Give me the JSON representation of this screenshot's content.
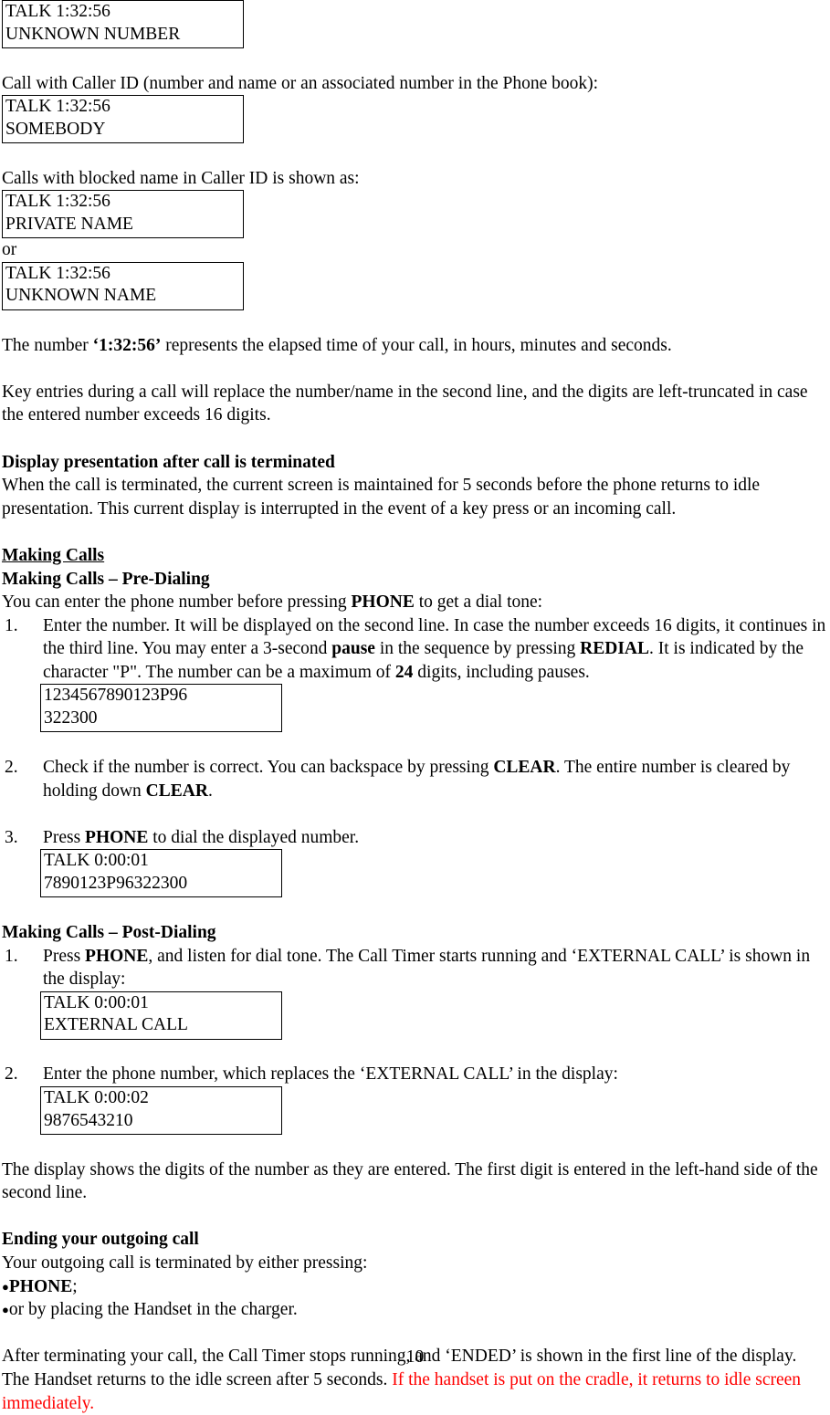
{
  "page": {
    "number": "10"
  },
  "colors": {
    "text": "#000000",
    "highlight_red": "#ff0000",
    "box_border": "#000000",
    "background": "#ffffff"
  },
  "blocks": {
    "lcd_unknown_number": {
      "line1": "TALK 1:32:56",
      "line2": "UNKNOWN NUMBER"
    },
    "caller_id_intro": "Call with Caller ID (number and name or an associated number in the Phone book):",
    "lcd_somebody": {
      "line1": "TALK 1:32:56",
      "line2": "SOMEBODY"
    },
    "blocked_name_intro": "Calls with blocked name in Caller ID is shown as:",
    "lcd_private_name": {
      "line1": "TALK 1:32:56",
      "line2": "PRIVATE NAME"
    },
    "or_label": "or",
    "lcd_unknown_name": {
      "line1": "TALK 1:32:56",
      "line2": "UNKNOWN NAME"
    },
    "elapsed_time_para": {
      "part1": "The number ",
      "bold": "‘1:32:56’",
      "part2": " represents the elapsed time of your call, in hours, minutes and seconds."
    },
    "key_entries_para": "Key entries during a call will replace the number/name in the second line, and the digits are left-truncated in case the entered number exceeds 16 digits.",
    "display_after_terminated": {
      "heading": "Display presentation after call is terminated",
      "body": "When the call is terminated, the current screen is maintained for 5 seconds before the phone returns to idle presentation. This current display is interrupted in the event of a key press or an incoming call."
    },
    "making_calls": {
      "heading": "Making Calls",
      "predialing_heading": "Making Calls – Pre-Dialing",
      "predialing_intro": {
        "part1": "You can enter the phone number before pressing ",
        "bold": "PHONE",
        "part2": " to get a dial tone:"
      },
      "step1": {
        "num": "1.",
        "t1": "Enter the number.  It will be displayed on the second line. In case the number exceeds 16 digits, it continues in the third line. You may enter a 3-second ",
        "b1": "pause",
        "t2": " in the sequence by pressing ",
        "b2": "REDIAL",
        "t3": ".  It is indicated by the character \"P\".  The number can be a maximum of ",
        "b3": "24",
        "t4": " digits, including pauses."
      },
      "lcd_entered_number": {
        "line1": "1234567890123P96",
        "line2": "322300"
      },
      "step2": {
        "num": "2.",
        "t1": "Check if the number is correct. You can backspace by pressing ",
        "b1": "CLEAR",
        "t2": ". The entire number is cleared by holding down ",
        "b2": "CLEAR",
        "t3": "."
      },
      "step3": {
        "num": "3.",
        "t1": "Press ",
        "b1": "PHONE",
        "t2": " to dial the displayed number."
      },
      "lcd_dialed": {
        "line1": "TALK 0:00:01",
        "line2": "7890123P96322300"
      },
      "postdialing_heading": "Making Calls – Post-Dialing",
      "post_step1": {
        "num": "1.",
        "t1": "Press ",
        "b1": "PHONE",
        "t2": ", and listen for dial tone.  The Call Timer starts running and ‘EXTERNAL CALL’ is shown in the display:"
      },
      "lcd_external_call": {
        "line1": "TALK 0:00:01",
        "line2": "EXTERNAL CALL"
      },
      "post_step2": {
        "num": "2.",
        "t1": "Enter the phone number, which replaces the ‘EXTERNAL CALL’ in the display:"
      },
      "lcd_entered_phone": {
        "line1": "TALK 0:00:02",
        "line2": "9876543210"
      },
      "display_shows_para": "The display shows the digits of the number as they are entered. The first digit is entered in the left-hand side of the second line."
    },
    "ending_call": {
      "heading": "Ending your outgoing call",
      "intro": "Your outgoing call is terminated by either pressing:",
      "bullet1_bold": "PHONE",
      "bullet1_tail": ";",
      "bullet2": "or by placing the Handset in the charger.",
      "closing_black": "After terminating your call, the Call Timer stops running, and ‘ENDED’ is shown in the first line of the display. The Handset returns to the idle screen after 5 seconds. ",
      "closing_red": "If the handset is put on the cradle, it returns to idle screen immediately."
    }
  }
}
